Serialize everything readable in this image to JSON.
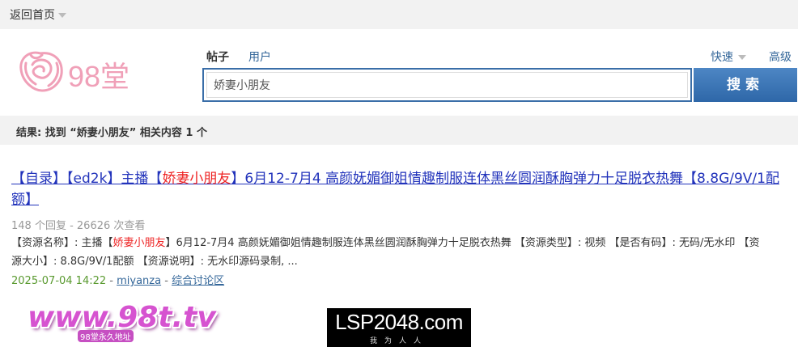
{
  "topbar": {
    "back_home": "返回首页"
  },
  "logo": {
    "text": "98堂"
  },
  "search": {
    "tab_posts": "帖子",
    "tab_users": "用户",
    "quick": "快速",
    "advanced": "高级",
    "value": "娇妻小朋友",
    "button": "搜索"
  },
  "results": {
    "summary": "结果: 找到 “娇妻小朋友” 相关内容 1 个"
  },
  "post": {
    "title_pre": "【自录】【ed2k】主播【",
    "title_hl": "娇妻小朋友",
    "title_post": "】6月12-7月4 高颜妩媚御姐情趣制服连体黑丝圆润酥胸弹力十足脱衣热舞【8.8G/9V/1配额】",
    "meta": "148 个回复 - 26626 次查看",
    "summary_pre": "【资源名称】: 主播【",
    "summary_hl": "娇妻小朋友",
    "summary_post": "】6月12-7月4 高颜妩媚御姐情趣制服连体黑丝圆润酥胸弹力十足脱衣热舞 【资源类型】: 视频 【是否有码】: 无码/无水印 【资源大小】: 8.8G/9V/1配额 【资源说明】: 无水印源码录制, ...",
    "date": "2025-07-04 14:22",
    "sep1": " - ",
    "author": "miyanza",
    "sep2": " - ",
    "forum": "综合讨论区"
  },
  "banners": {
    "site98": "www.98t.tv",
    "site98_sub": "98堂永久地址",
    "lsp_main": "LSP2048.com",
    "lsp_sub": "我为人人"
  },
  "colors": {
    "accent": "#3a6ea8",
    "highlight": "#ee2222",
    "link": "#2233bb",
    "date": "#5a9a30"
  }
}
